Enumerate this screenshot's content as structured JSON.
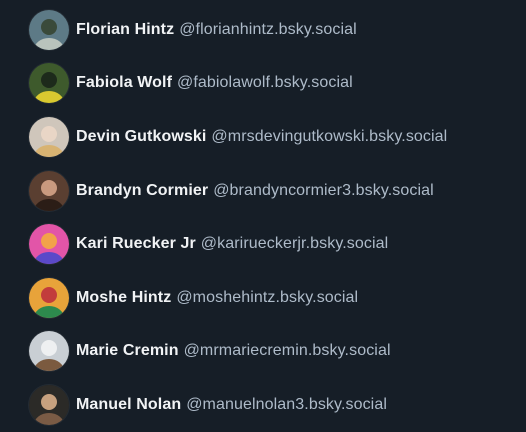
{
  "users": [
    {
      "name": "Florian Hintz",
      "handle": "@florianhintz.bsky.social",
      "avatar": "avatar-person-outdoors-icon",
      "colors": [
        "#5d7a86",
        "#b9c3bc",
        "#3a4a3a"
      ]
    },
    {
      "name": "Fabiola Wolf",
      "handle": "@fabiolawolf.bsky.social",
      "avatar": "avatar-person-yellow-cap-icon",
      "colors": [
        "#3e5a2c",
        "#d9c930",
        "#1d2a1b"
      ]
    },
    {
      "name": "Devin Gutkowski",
      "handle": "@mrsdevingutkowski.bsky.social",
      "avatar": "avatar-person-blonde-icon",
      "colors": [
        "#cfc6bb",
        "#d8b372",
        "#e9d6c6"
      ]
    },
    {
      "name": "Brandyn Cormier",
      "handle": "@brandyncormier3.bsky.social",
      "avatar": "avatar-person-dark-hair-icon",
      "colors": [
        "#5a3f31",
        "#2b1d16",
        "#c99a7f"
      ]
    },
    {
      "name": "Kari Ruecker Jr",
      "handle": "@karirueckerjr.bsky.social",
      "avatar": "avatar-colorful-art-icon",
      "colors": [
        "#e255a8",
        "#5a49c9",
        "#f2a24a"
      ]
    },
    {
      "name": "Moshe Hintz",
      "handle": "@moshehintz.bsky.social",
      "avatar": "avatar-illustration-icon",
      "colors": [
        "#e8a33a",
        "#2d8a4d",
        "#c23c3c"
      ]
    },
    {
      "name": "Marie Cremin",
      "handle": "@mrmariecremin.bsky.social",
      "avatar": "avatar-person-guitar-icon",
      "colors": [
        "#c9cfd4",
        "#7b5a3f",
        "#eef0f1"
      ]
    },
    {
      "name": "Manuel Nolan",
      "handle": "@manuelnolan3.bsky.social",
      "avatar": "avatar-person-dark-icon",
      "colors": [
        "#2b2a27",
        "#7a5b45",
        "#c7a17f"
      ]
    }
  ]
}
